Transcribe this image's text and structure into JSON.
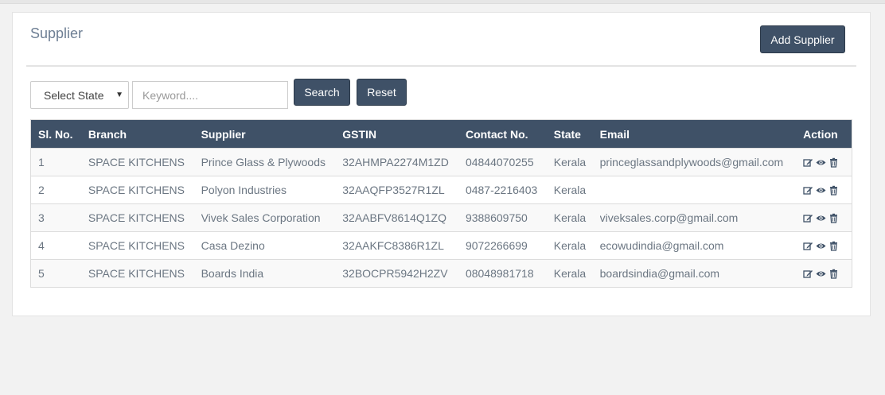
{
  "page": {
    "title": "Supplier",
    "add_button_label": "Add Supplier"
  },
  "filters": {
    "state_select_value": "Select State",
    "keyword_placeholder": "Keyword....",
    "search_label": "Search",
    "reset_label": "Reset"
  },
  "table": {
    "headers": {
      "sl_no": "Sl. No.",
      "branch": "Branch",
      "supplier": "Supplier",
      "gstin": "GSTIN",
      "contact": "Contact No.",
      "state": "State",
      "email": "Email",
      "action": "Action"
    },
    "rows": [
      {
        "sl_no": "1",
        "branch": "SPACE KITCHENS",
        "supplier": "Prince Glass & Plywoods",
        "gstin": "32AHMPA2274M1ZD",
        "contact": "04844070255",
        "state": "Kerala",
        "email": "princeglassandplywoods@gmail.com"
      },
      {
        "sl_no": "2",
        "branch": "SPACE KITCHENS",
        "supplier": "Polyon Industries",
        "gstin": "32AAQFP3527R1ZL",
        "contact": "0487-2216403",
        "state": "Kerala",
        "email": ""
      },
      {
        "sl_no": "3",
        "branch": "SPACE KITCHENS",
        "supplier": "Vivek Sales Corporation",
        "gstin": "32AABFV8614Q1ZQ",
        "contact": "9388609750",
        "state": "Kerala",
        "email": "viveksales.corp@gmail.com"
      },
      {
        "sl_no": "4",
        "branch": "SPACE KITCHENS",
        "supplier": "Casa Dezino",
        "gstin": "32AAKFC8386R1ZL",
        "contact": "9072266699",
        "state": "Kerala",
        "email": "ecowudindia@gmail.com"
      },
      {
        "sl_no": "5",
        "branch": "SPACE KITCHENS",
        "supplier": "Boards India",
        "gstin": "32BOCPR5942H2ZV",
        "contact": "08048981718",
        "state": "Kerala",
        "email": "boardsindia@gmail.com"
      }
    ],
    "action_icons": [
      "edit-icon",
      "view-icon",
      "delete-icon"
    ]
  },
  "colors": {
    "header_bg": "#3f5167",
    "button_bg": "#3f5167",
    "title_color": "#6e7f94"
  }
}
